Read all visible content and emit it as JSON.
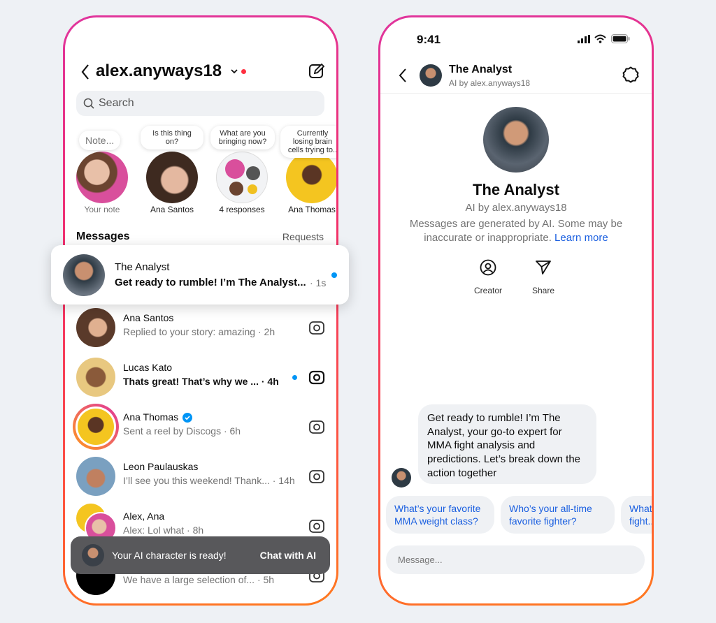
{
  "left": {
    "username": "alex.anyways18",
    "search_placeholder": "Search",
    "notes": [
      {
        "bubble": "Note...",
        "label": "Your note"
      },
      {
        "bubble": "Is this thing on?",
        "label": "Ana Santos"
      },
      {
        "bubble": "What are you bringing now?",
        "label": "4 responses"
      },
      {
        "bubble": "Currently losing brain cells trying to..",
        "label": "Ana Thomas"
      }
    ],
    "messages_label": "Messages",
    "requests_label": "Requests",
    "highlighted": {
      "name": "The Analyst",
      "message": "Get ready to rumble! I’m The Analyst...",
      "time": "· 1s"
    },
    "conversations": [
      {
        "name": "Ana Santos",
        "message": "Replied to your story: amazing · 2h",
        "unread": false
      },
      {
        "name": "Lucas Kato",
        "message": "Thats great! That’s why we ... · 4h",
        "unread": true
      },
      {
        "name": "Ana Thomas",
        "message": "Sent a reel by Discogs · 6h",
        "unread": false,
        "verified": true
      },
      {
        "name": "Leon Paulauskas",
        "message": "I’ll see you this weekend! Thank... · 14h",
        "unread": false
      },
      {
        "name": "Alex, Ana",
        "message": "Alex: Lol what · 8h",
        "unread": false
      },
      {
        "name": "",
        "message": "We have a large selection of... · 5h",
        "unread": false
      }
    ],
    "toast": {
      "text": "Your AI character is ready!",
      "action": "Chat with AI"
    }
  },
  "right": {
    "status_time": "9:41",
    "header_name": "The Analyst",
    "header_sub": "AI by alex.anyways18",
    "profile_name": "The Analyst",
    "profile_sub": "AI by alex.anyways18",
    "disclaimer": "Messages are generated by AI. Some may be inaccurate or inappropriate.",
    "learn_more": "Learn more",
    "creator_label": "Creator",
    "share_label": "Share",
    "bubble": "Get ready to rumble! I’m The Analyst, your go-to expert for MMA fight analysis and predictions. Let’s break down the action together",
    "chips": [
      "What’s your favorite MMA weight class?",
      "Who’s your all-time favorite fighter?",
      "What fight..."
    ],
    "message_placeholder": "Message..."
  },
  "colors": {
    "accent": "#0095f6",
    "link": "#1a5fe0",
    "notify": "#ff3040",
    "toast": "#58585b"
  }
}
